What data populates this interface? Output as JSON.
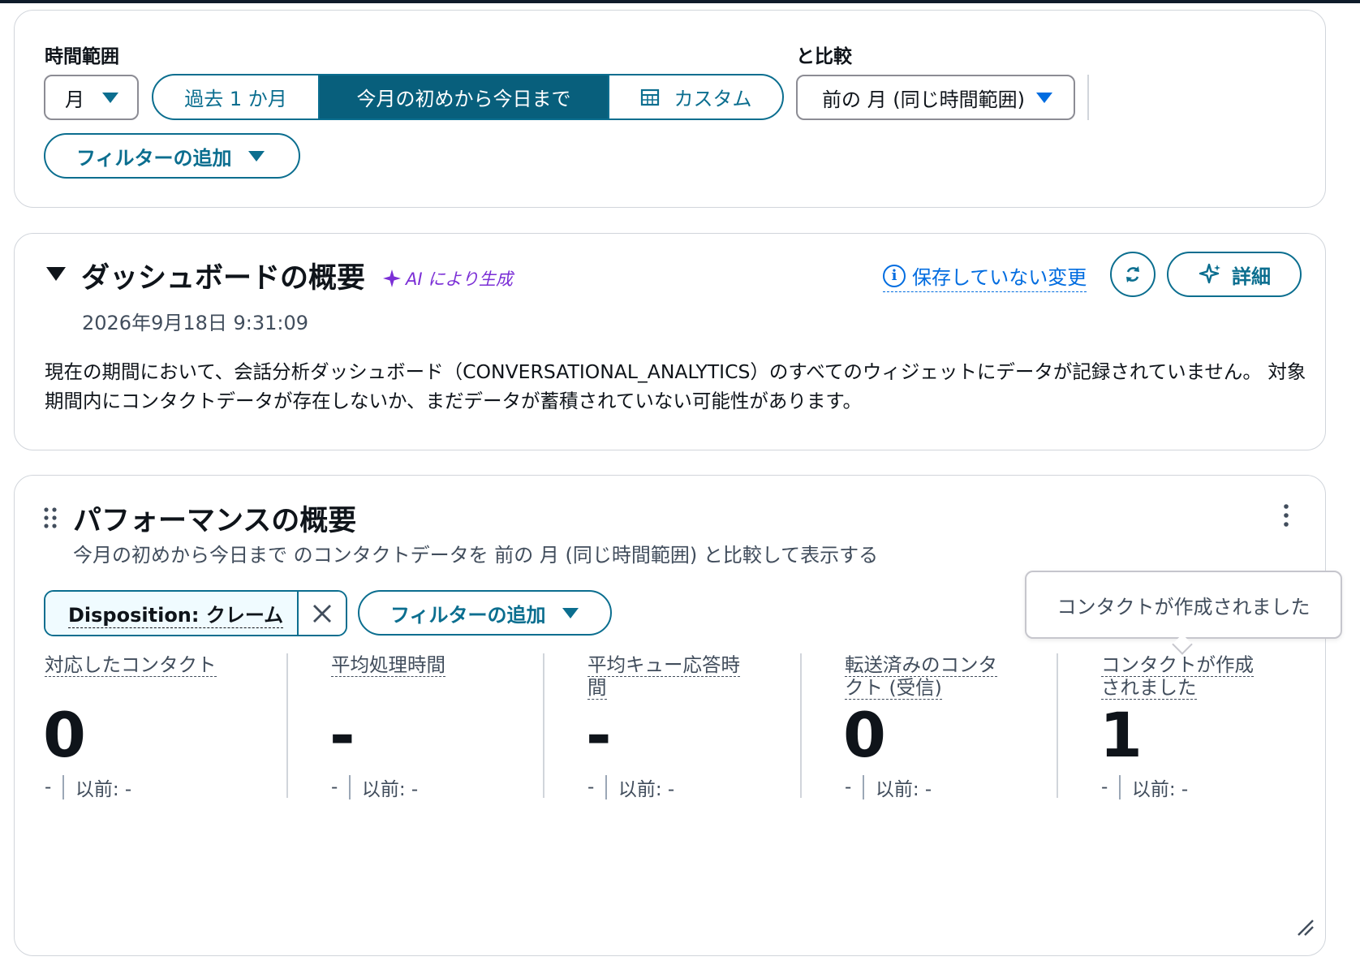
{
  "time_range": {
    "label": "時間範囲",
    "granularity": "月",
    "options": [
      "過去 1 か月",
      "今月の初めから今日まで",
      "カスタム"
    ],
    "selected": "今月の初めから今日まで",
    "compare_label": "と比較",
    "compare_value": "前の 月 (同じ時間範囲)",
    "add_filter": "フィルターの追加"
  },
  "summary": {
    "title": "ダッシュボードの概要",
    "ai_badge": "AI により生成",
    "timestamp": "2026年9月18日 9:31:09",
    "unsaved_link": "保存していない変更",
    "details_button": "詳細",
    "body": "現在の期間において、会話分析ダッシュボード（CONVERSATIONAL_ANALYTICS）のすべてのウィジェットにデータが記録されていません。 対象期間内にコンタクトデータが存在しないか、まだデータが蓄積されていない可能性があります。"
  },
  "performance": {
    "title": "パフォーマンスの概要",
    "subtitle": "今月の初めから今日まで のコンタクトデータを 前の 月 (同じ時間範囲) と比較して表示する",
    "filter_chip": "Disposition: クレーム",
    "add_filter": "フィルターの追加",
    "tooltip": "コンタクトが作成されました",
    "metrics": [
      {
        "label": "対応したコンタクト",
        "value": "0",
        "delta": "-",
        "previous": "以前: -"
      },
      {
        "label": "平均処理時間",
        "value": "-",
        "delta": "-",
        "previous": "以前: -"
      },
      {
        "label": "平均キュー応答時間",
        "value": "-",
        "delta": "-",
        "previous": "以前: -"
      },
      {
        "label": "転送済みのコンタクト (受信)",
        "value": "0",
        "delta": "-",
        "previous": "以前: -"
      },
      {
        "label": "コンタクトが作成されました",
        "value": "1",
        "delta": "-",
        "previous": "以前: -"
      }
    ]
  },
  "colors": {
    "accent": "#0b6e8f",
    "selected_segment": "#085f7c",
    "link": "#006ce0",
    "ai": "#7b2fd6",
    "border": "#d1d5db"
  }
}
